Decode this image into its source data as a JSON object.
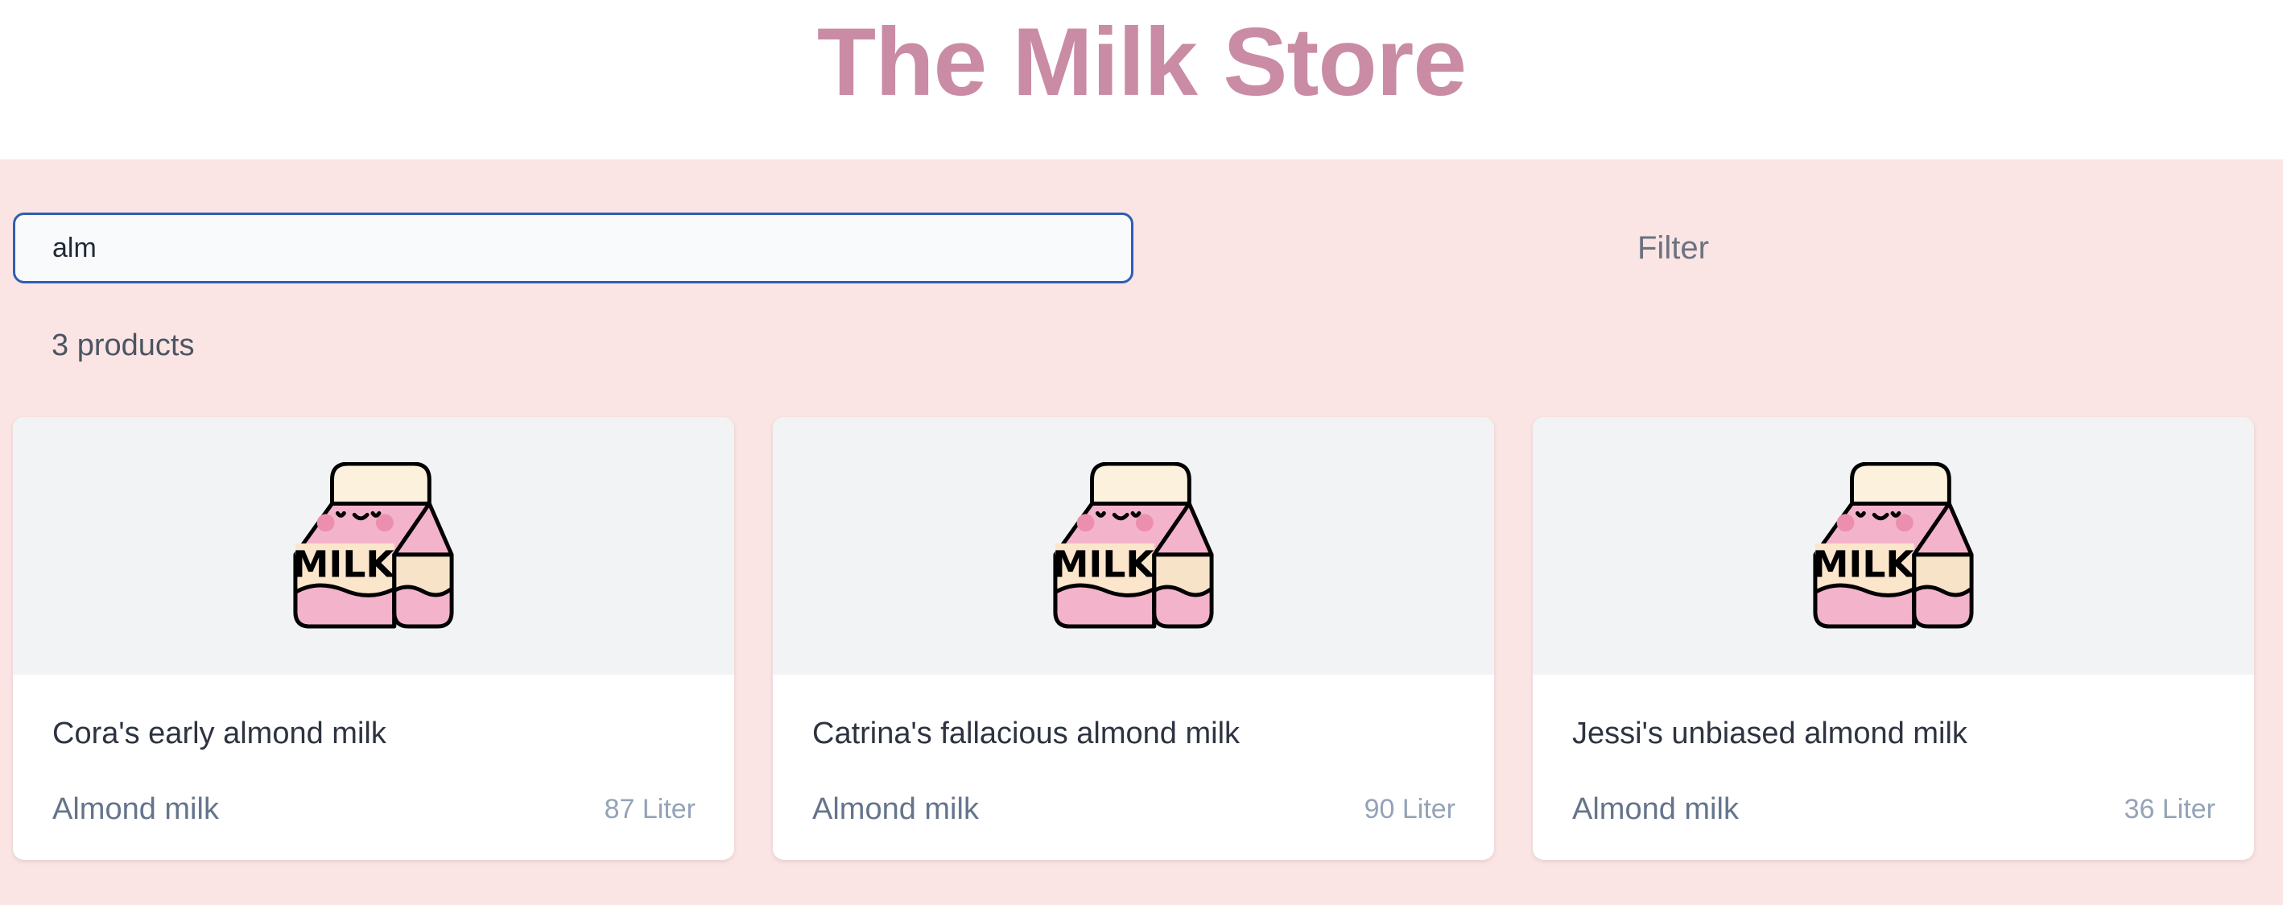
{
  "header": {
    "title": "The Milk Store"
  },
  "search": {
    "value": "alm",
    "placeholder": ""
  },
  "filter": {
    "label": "Filter"
  },
  "results": {
    "count_label": "3 products"
  },
  "icon": {
    "name": "milk-carton-icon",
    "text": "MILK"
  },
  "colors": {
    "brand": "#c98ca4",
    "background": "#fbe4e4",
    "search_border": "#2f5db3",
    "card_media": "#f2f3f5"
  },
  "products": [
    {
      "name": "Cora's early almond milk",
      "type": "Almond milk",
      "quantity": "87 Liter"
    },
    {
      "name": "Catrina's fallacious almond milk",
      "type": "Almond milk",
      "quantity": "90 Liter"
    },
    {
      "name": "Jessi's unbiased almond milk",
      "type": "Almond milk",
      "quantity": "36 Liter"
    }
  ]
}
